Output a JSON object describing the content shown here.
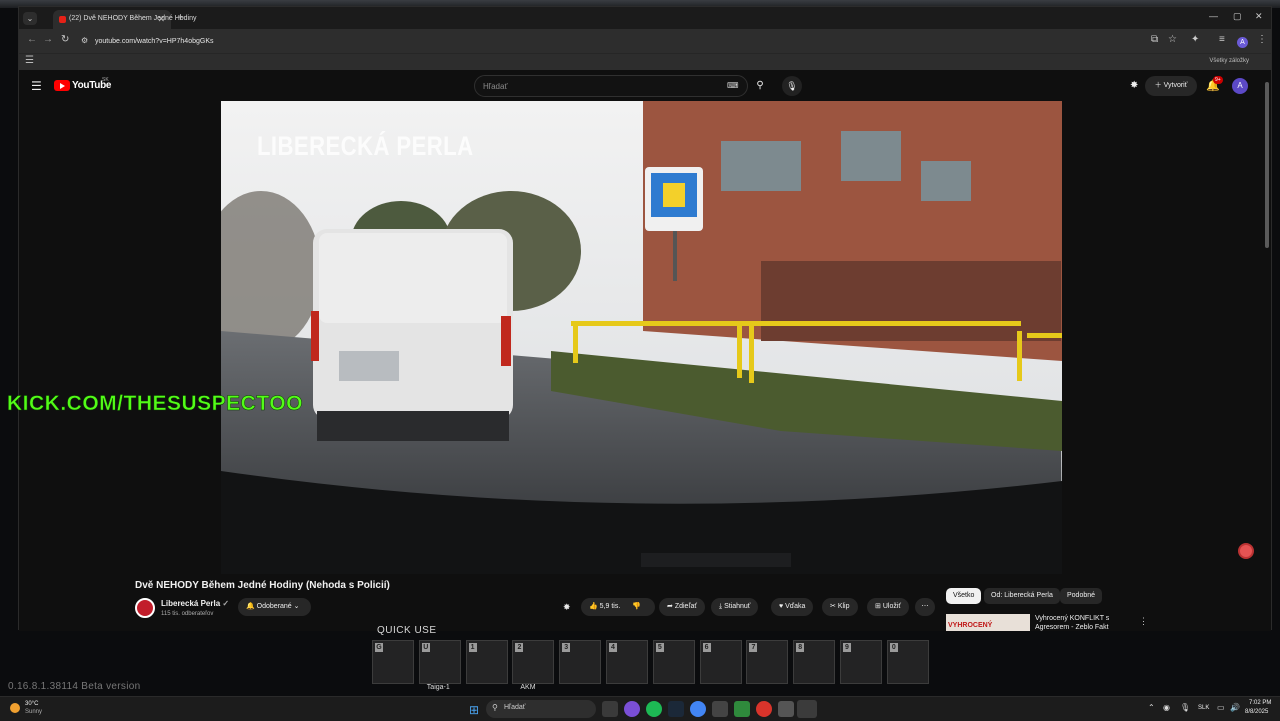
{
  "browser": {
    "tab_title": "(22) Dvě NEHODY Během Jedné Hodiny",
    "tab_sound_icon": "speaker-icon",
    "url": "youtube.com/watch?v=HP7h4obgGKs",
    "bookmarks_all": "Všetky záložky",
    "profile_initial": "A"
  },
  "youtube": {
    "logo_text": "YouTube",
    "logo_country": "SK",
    "search_placeholder": "Hľadať",
    "create_label": "Vytvoriť",
    "notif_badge": "9+",
    "avatar_initial": "A",
    "video": {
      "overlay_text": "LIBERECKÁ PERLA",
      "title": "Dvě NEHODY Během Jedné Hodiny (Nehoda s Policií)"
    },
    "channel": {
      "name": "Liberecká Perla",
      "subscribers": "115 tis. odberateľov",
      "subscribed_label": "Odoberané"
    },
    "actions": {
      "likes": "5,9 tis.",
      "share": "Zdieľať",
      "download": "Stiahnuť",
      "thanks": "Vďaka",
      "clip": "Klip",
      "save": "Uložiť"
    },
    "chips": [
      "Všetko",
      "Od: Liberecká Perla",
      "Podobné"
    ],
    "recommendation": {
      "title": "Vyhrocený KONFLIKT s Agresorem - Zeblo Fakt",
      "thumb_text": "VYHROCENÝ"
    }
  },
  "stream_overlay": {
    "kick": "KICK.COM/THESUSPECTOO"
  },
  "game": {
    "quick_use_label": "QUICK USE",
    "slots": [
      {
        "key": "G",
        "label": ""
      },
      {
        "key": "U",
        "label": "Taiga-1"
      },
      {
        "key": "1",
        "label": ""
      },
      {
        "key": "2",
        "label": "AKM"
      },
      {
        "key": "3",
        "label": ""
      },
      {
        "key": "4",
        "label": ""
      },
      {
        "key": "5",
        "label": ""
      },
      {
        "key": "6",
        "label": ""
      },
      {
        "key": "7",
        "label": ""
      },
      {
        "key": "8",
        "label": ""
      },
      {
        "key": "9",
        "label": ""
      },
      {
        "key": "0",
        "label": ""
      }
    ],
    "version": "0.16.8.1.38114 Beta version"
  },
  "taskbar": {
    "weather_temp": "30°C",
    "weather_desc": "Sunny",
    "search_placeholder": "Hľadať",
    "lang": "SLK",
    "time": "7:02 PM",
    "date": "8/8/2025"
  },
  "colors": {
    "youtube_red": "#ff0000",
    "kick_green": "#53fc18",
    "railing_yellow": "#e6c91a"
  }
}
